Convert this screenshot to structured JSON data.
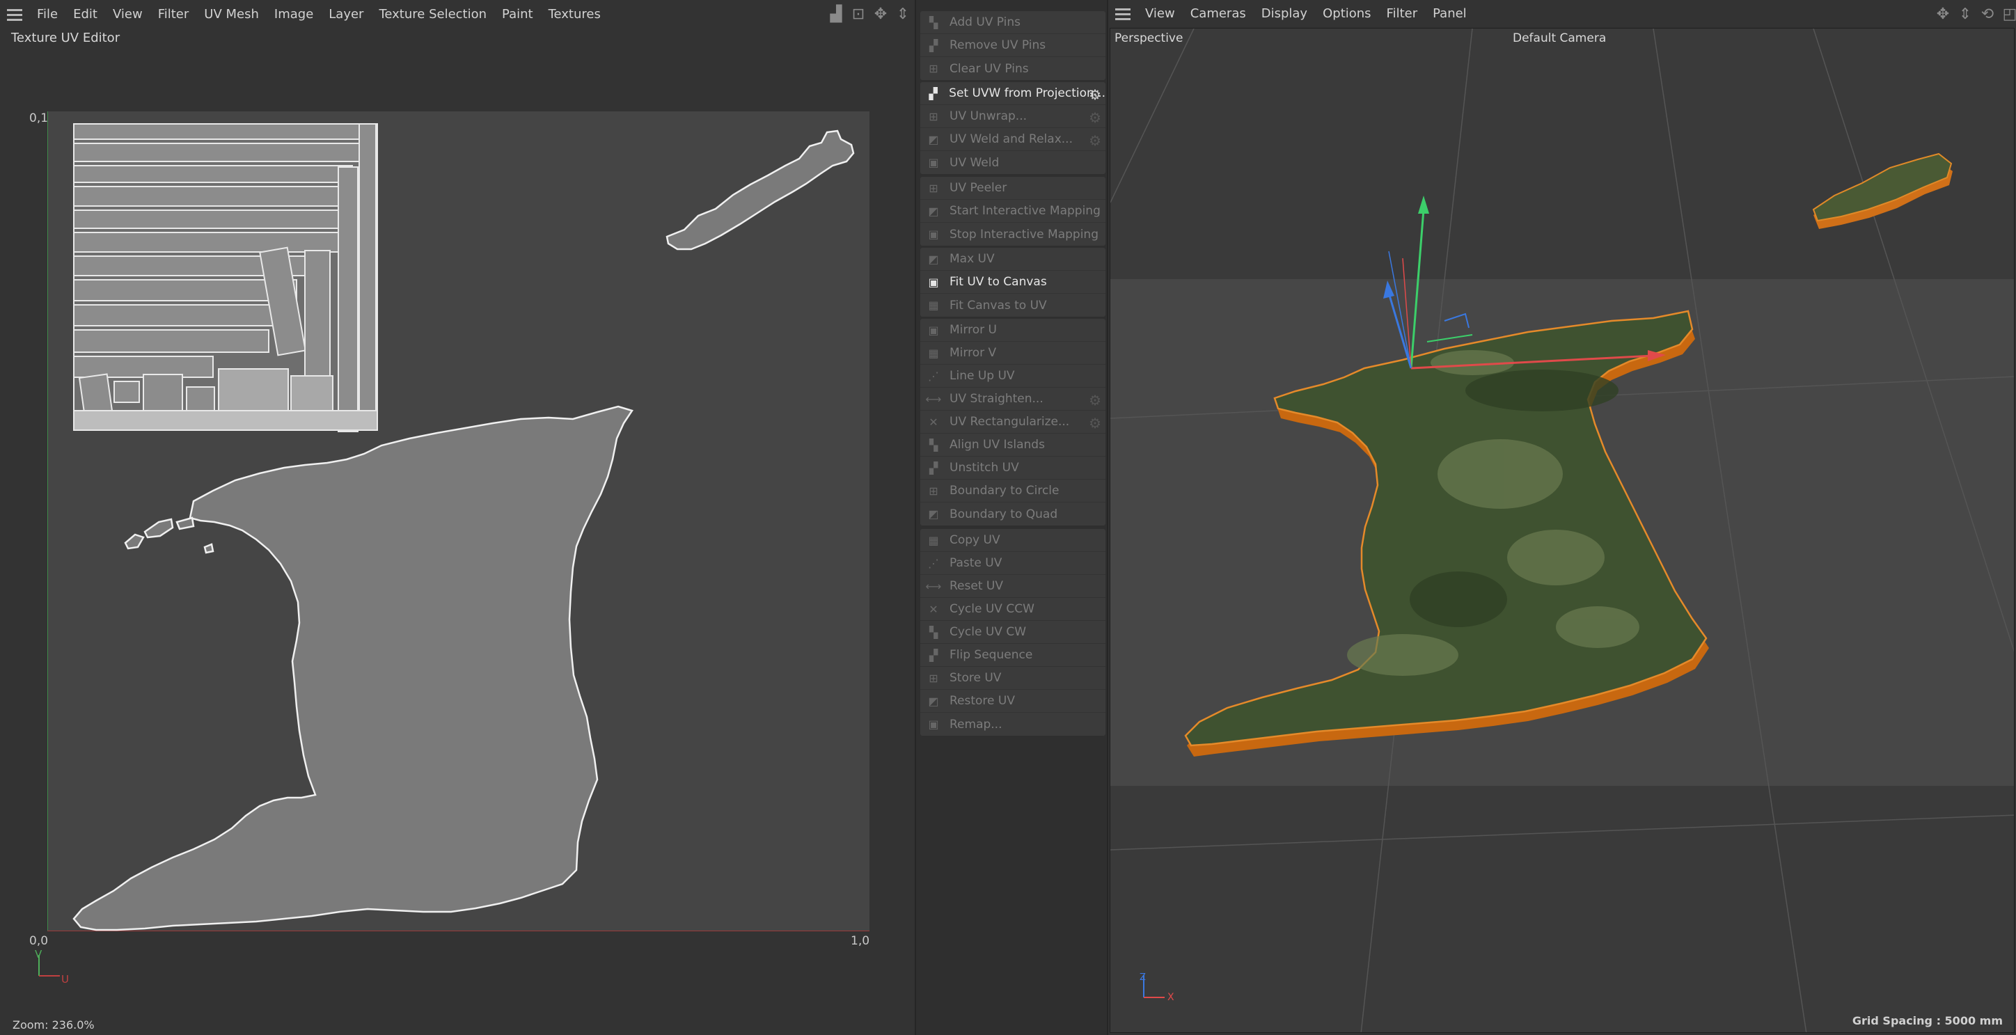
{
  "uv_editor": {
    "menu": [
      "File",
      "Edit",
      "View",
      "Filter",
      "UV Mesh",
      "Image",
      "Layer",
      "Texture Selection",
      "Paint",
      "Textures"
    ],
    "title": "Texture UV Editor",
    "axis": {
      "top_left": "0,1",
      "bottom_left": "0,0",
      "bottom_right": "1,0",
      "v": "V",
      "u": "U"
    },
    "zoom": "Zoom: 236.0%"
  },
  "commands": {
    "groups": [
      [
        {
          "label": "Add UV Pins",
          "enabled": false,
          "gear": false
        },
        {
          "label": "Remove UV Pins",
          "enabled": false,
          "gear": false
        },
        {
          "label": "Clear UV Pins",
          "enabled": false,
          "gear": false
        }
      ],
      [
        {
          "label": "Set UVW from Projection...",
          "enabled": true,
          "gear": true
        },
        {
          "label": "UV Unwrap...",
          "enabled": false,
          "gear": true
        },
        {
          "label": "UV Weld and Relax...",
          "enabled": false,
          "gear": true
        },
        {
          "label": "UV Weld",
          "enabled": false,
          "gear": false
        }
      ],
      [
        {
          "label": "UV Peeler",
          "enabled": false,
          "gear": false
        },
        {
          "label": "Start Interactive Mapping",
          "enabled": false,
          "gear": false
        },
        {
          "label": "Stop Interactive Mapping",
          "enabled": false,
          "gear": false
        }
      ],
      [
        {
          "label": "Max UV",
          "enabled": false,
          "gear": false
        },
        {
          "label": "Fit UV to Canvas",
          "enabled": true,
          "gear": false
        },
        {
          "label": "Fit Canvas to UV",
          "enabled": false,
          "gear": false
        }
      ],
      [
        {
          "label": "Mirror U",
          "enabled": false,
          "gear": false
        },
        {
          "label": "Mirror V",
          "enabled": false,
          "gear": false
        },
        {
          "label": "Line Up UV",
          "enabled": false,
          "gear": false
        },
        {
          "label": "UV Straighten...",
          "enabled": false,
          "gear": true
        },
        {
          "label": "UV Rectangularize...",
          "enabled": false,
          "gear": true
        },
        {
          "label": "Align UV Islands",
          "enabled": false,
          "gear": false
        },
        {
          "label": "Unstitch UV",
          "enabled": false,
          "gear": false
        },
        {
          "label": "Boundary to Circle",
          "enabled": false,
          "gear": false
        },
        {
          "label": "Boundary to Quad",
          "enabled": false,
          "gear": false
        }
      ],
      [
        {
          "label": "Copy UV",
          "enabled": false,
          "gear": false
        },
        {
          "label": "Paste UV",
          "enabled": false,
          "gear": false
        },
        {
          "label": "Reset UV",
          "enabled": false,
          "gear": false
        },
        {
          "label": "Cycle UV CCW",
          "enabled": false,
          "gear": false
        },
        {
          "label": "Cycle UV CW",
          "enabled": false,
          "gear": false
        },
        {
          "label": "Flip Sequence",
          "enabled": false,
          "gear": false
        },
        {
          "label": "Store UV",
          "enabled": false,
          "gear": false
        },
        {
          "label": "Restore UV",
          "enabled": false,
          "gear": false
        },
        {
          "label": "Remap...",
          "enabled": false,
          "gear": false
        }
      ]
    ]
  },
  "viewport": {
    "menu": [
      "View",
      "Cameras",
      "Display",
      "Options",
      "Filter",
      "Panel"
    ],
    "view_name": "Perspective",
    "camera": "Default Camera",
    "grid_spacing": "Grid Spacing : 5000 mm",
    "axis_z": "Z",
    "axis_x": "X"
  },
  "colors": {
    "accent_orange": "#e07a1a",
    "island_fill": "#7a7a7a",
    "uv_canvas": "#454545"
  }
}
